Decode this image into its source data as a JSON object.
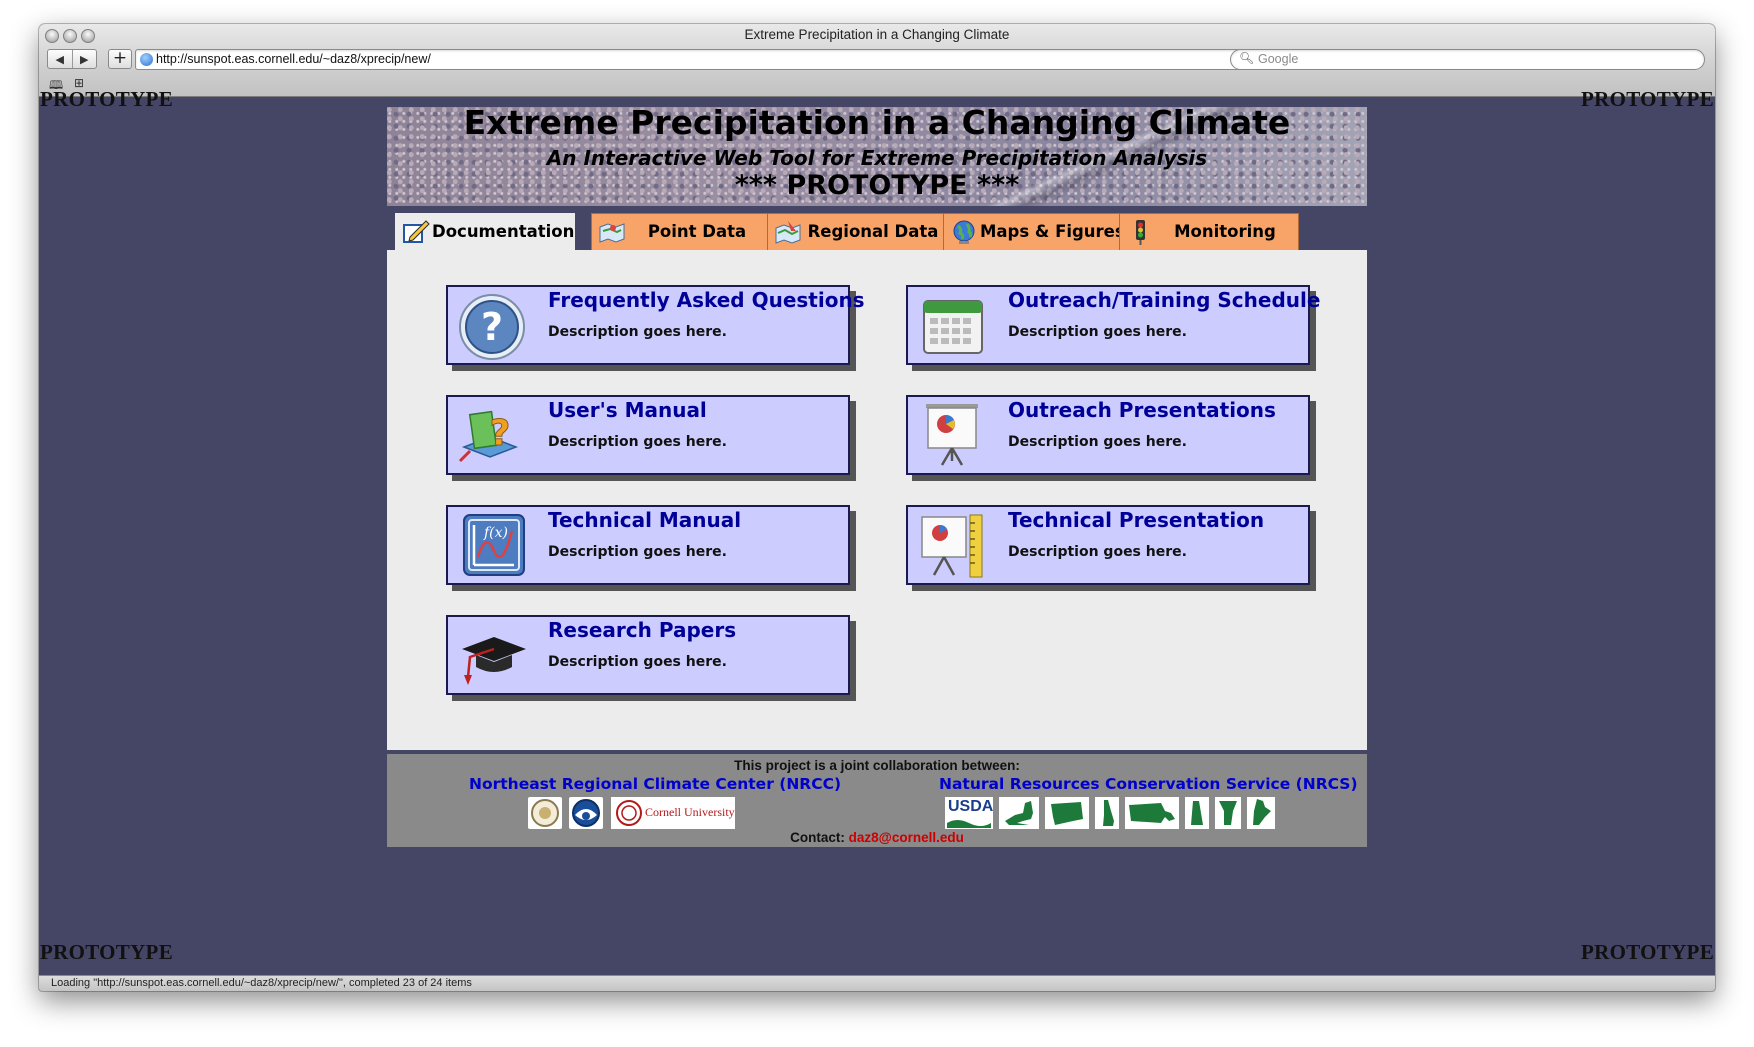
{
  "browser": {
    "window_title": "Extreme Precipitation in a Changing Climate",
    "url": "http://sunspot.eas.cornell.edu/~daz8/xprecip/new/",
    "search_placeholder": "Google",
    "status_text": "Loading \"http://sunspot.eas.cornell.edu/~daz8/xprecip/new/\", completed 23 of 24 items"
  },
  "watermark": "PROTOTYPE",
  "banner": {
    "title": "Extreme Precipitation in a Changing Climate",
    "subtitle": "An Interactive Web Tool for Extreme Precipitation Analysis",
    "prototype": "*** PROTOTYPE ***"
  },
  "tabs": [
    {
      "label": "Documentation",
      "icon": "pencil-doc-icon",
      "active": true
    },
    {
      "label": "Point Data",
      "icon": "map-point-icon",
      "active": false
    },
    {
      "label": "Regional Data",
      "icon": "region-map-icon",
      "active": false
    },
    {
      "label": "Maps & Figures",
      "icon": "globe-icon",
      "active": false
    },
    {
      "label": "Monitoring",
      "icon": "traffic-light-icon",
      "active": false
    }
  ],
  "cards": [
    {
      "title": "Frequently Asked Questions",
      "desc": "Description goes here.",
      "icon": "question-icon"
    },
    {
      "title": "Outreach/Training Schedule",
      "desc": "Description goes here.",
      "icon": "calendar-icon"
    },
    {
      "title": "User's Manual",
      "desc": "Description goes here.",
      "icon": "manual-icon"
    },
    {
      "title": "Outreach Presentations",
      "desc": "Description goes here.",
      "icon": "presentation-icon"
    },
    {
      "title": "Technical Manual",
      "desc": "Description goes here.",
      "icon": "function-graph-icon"
    },
    {
      "title": "Technical Presentation",
      "desc": "Description goes here.",
      "icon": "technical-presentation-icon"
    },
    {
      "title": "Research Papers",
      "desc": "Description goes here.",
      "icon": "graduation-cap-icon"
    }
  ],
  "footer": {
    "collab": "This project is a joint collaboration between:",
    "nrcc": "Northeast Regional Climate Center (NRCC)",
    "nrcs": "Natural Resources Conservation Service (NRCS)",
    "cornell": "Cornell University",
    "usda": "USDA",
    "contact_label": "Contact:",
    "contact_email": "daz8@cornell.edu"
  },
  "colors": {
    "page_bg": "#454566",
    "tab_orange": "#f8a468",
    "card_bg": "#ccccff",
    "card_title": "#000099",
    "panel_bg": "#ececec",
    "footer_bg": "#8a8a8a",
    "link_blue": "#0000cc",
    "email_red": "#cc0000"
  }
}
